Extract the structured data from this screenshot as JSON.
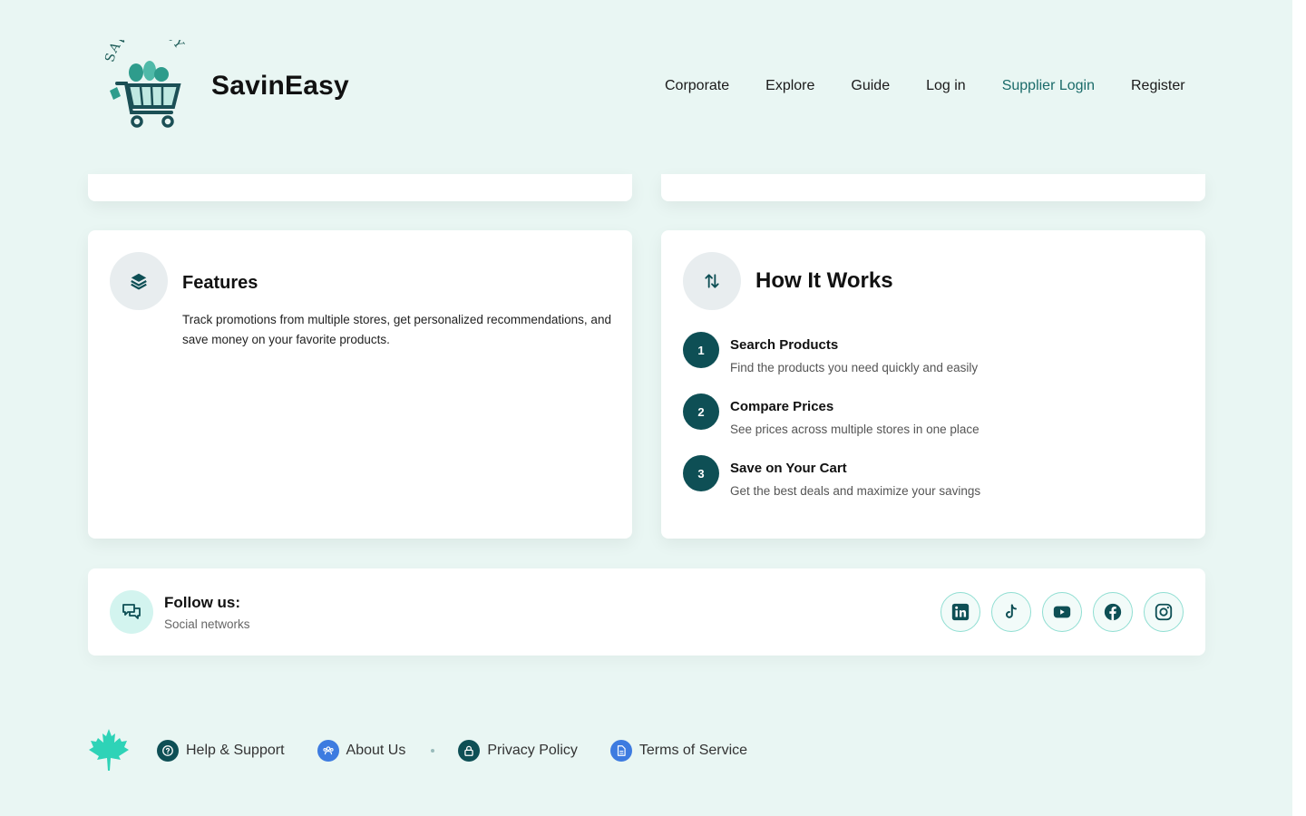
{
  "brand": {
    "name": "SavinEasy",
    "logo_text": "SAVINEASY"
  },
  "nav": {
    "items": [
      {
        "label": "Corporate"
      },
      {
        "label": "Explore"
      },
      {
        "label": "Guide"
      },
      {
        "label": "Log in"
      },
      {
        "label": "Supplier Login"
      },
      {
        "label": "Register"
      }
    ]
  },
  "features": {
    "title": "Features",
    "text": "Track promotions from multiple stores, get personalized recommendations, and save money on your favorite products.",
    "icon": "layers-icon"
  },
  "how": {
    "title": "How It Works",
    "icon": "swap-vertical-icon",
    "steps": [
      {
        "num": "1",
        "title": "Search Products",
        "desc": "Find the products you need quickly and easily"
      },
      {
        "num": "2",
        "title": "Compare Prices",
        "desc": "See prices across multiple stores in one place"
      },
      {
        "num": "3",
        "title": "Save on Your Cart",
        "desc": "Get the best deals and maximize your savings"
      }
    ]
  },
  "follow": {
    "title": "Follow us:",
    "subtitle": "Social networks",
    "socials": [
      "linkedin-icon",
      "tiktok-icon",
      "youtube-icon",
      "facebook-icon",
      "instagram-icon"
    ]
  },
  "footer": {
    "links": [
      {
        "label": "Help & Support",
        "icon": "help-icon"
      },
      {
        "label": "About Us",
        "icon": "team-icon"
      },
      {
        "label": "Privacy Policy",
        "icon": "lock-icon"
      },
      {
        "label": "Terms of Service",
        "icon": "document-icon"
      }
    ]
  },
  "colors": {
    "background": "#e9f6f3",
    "accent": "#0e4f55",
    "link_active": "#1b6b6a",
    "social_border": "#8fded2",
    "maple": "#2ed3b7"
  }
}
